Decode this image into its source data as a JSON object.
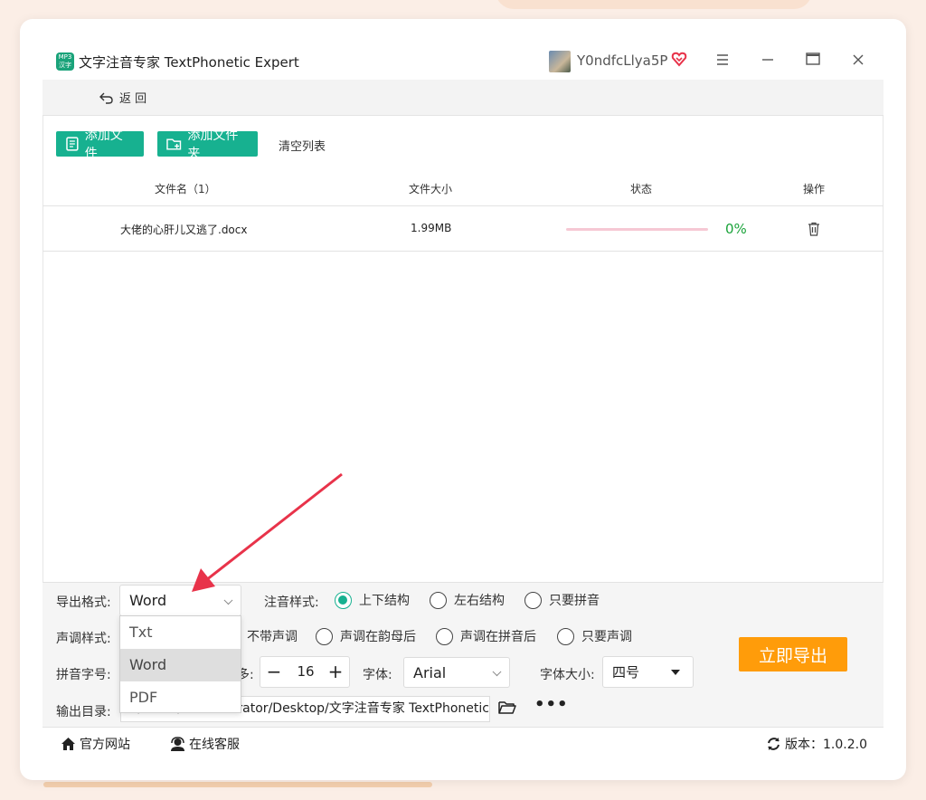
{
  "app": {
    "logo_text": "MP3\n汉字",
    "title": "文字注音专家 TextPhonetic Expert",
    "username": "Y0ndfcLlya5P"
  },
  "nav": {
    "back_label": "返 回"
  },
  "toolbar": {
    "add_file": "添加文件",
    "add_folder": "添加文件夹",
    "clear_list": "清空列表"
  },
  "table": {
    "headers": [
      "文件名（1）",
      "文件大小",
      "状态",
      "操作"
    ],
    "rows": [
      {
        "name": "大佬的心肝儿又逃了.docx",
        "size": "1.99MB",
        "progress": 0,
        "status": "0%"
      }
    ]
  },
  "settings": {
    "export_format_label": "导出格式:",
    "export_format_value": "Word",
    "export_format_options": [
      "Txt",
      "Word",
      "PDF"
    ],
    "annotation_style_label": "注音样式:",
    "annotation_styles": [
      "上下结构",
      "左右结构",
      "只要拼音"
    ],
    "annotation_style_selected": "上下结构",
    "tone_style_label": "声调样式:",
    "tone_styles": [
      "不带声调",
      "声调在韵母后",
      "声调在拼音后",
      "只要声调"
    ],
    "pinyin_size_label": "拼音字号:",
    "pinyin_size_partial": "多:",
    "pinyin_size_value": "16",
    "font_label": "字体:",
    "font_value": "Arial",
    "font_size_label": "字体大小:",
    "font_size_value": "四号",
    "output_dir_label": "输出目录:",
    "output_dir_value": "C:/Users/Administrator/Desktop/文字注音专家 TextPhonetic Expert",
    "more": "•••",
    "export_button": "立即导出"
  },
  "footer": {
    "website": "官方网站",
    "support": "在线客服",
    "version": "版本：1.0.2.0"
  },
  "colors": {
    "accent": "#17b190",
    "export": "#ff9c0a",
    "percent": "#1aa33a",
    "arrow": "#e8334a"
  }
}
